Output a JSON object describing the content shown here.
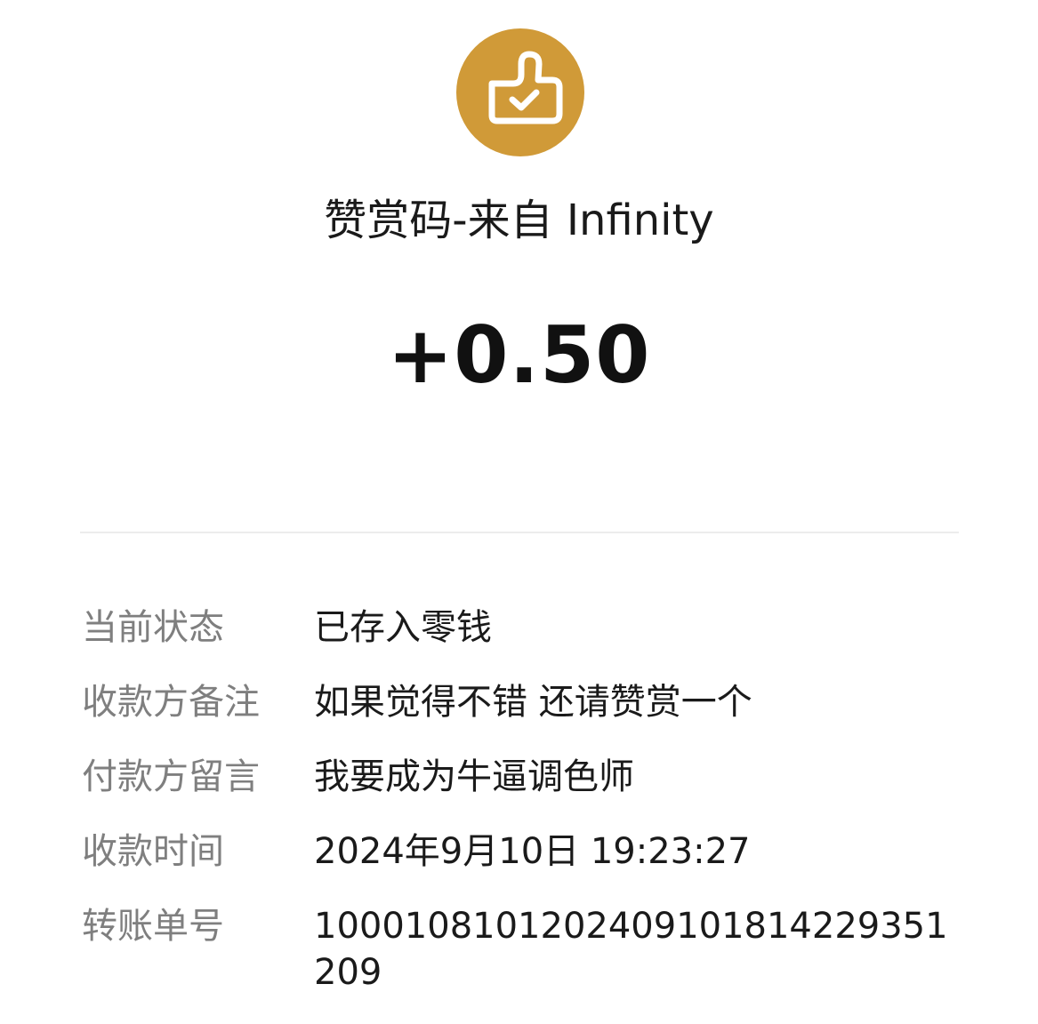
{
  "header": {
    "icon": "thumbs-up-check-icon",
    "icon_bg_color": "#d09a38",
    "title": "赞赏码-来自 Infinity",
    "amount": "+0.50"
  },
  "details": [
    {
      "label": "当前状态",
      "value": "已存入零钱"
    },
    {
      "label": "收款方备注",
      "value": "如果觉得不错 还请赞赏一个"
    },
    {
      "label": "付款方留言",
      "value": "我要成为牛逼调色师"
    },
    {
      "label": "收款时间",
      "value": "2024年9月10日 19:23:27"
    },
    {
      "label": "转账单号",
      "value": "100010810120240910181422935120​9"
    }
  ]
}
